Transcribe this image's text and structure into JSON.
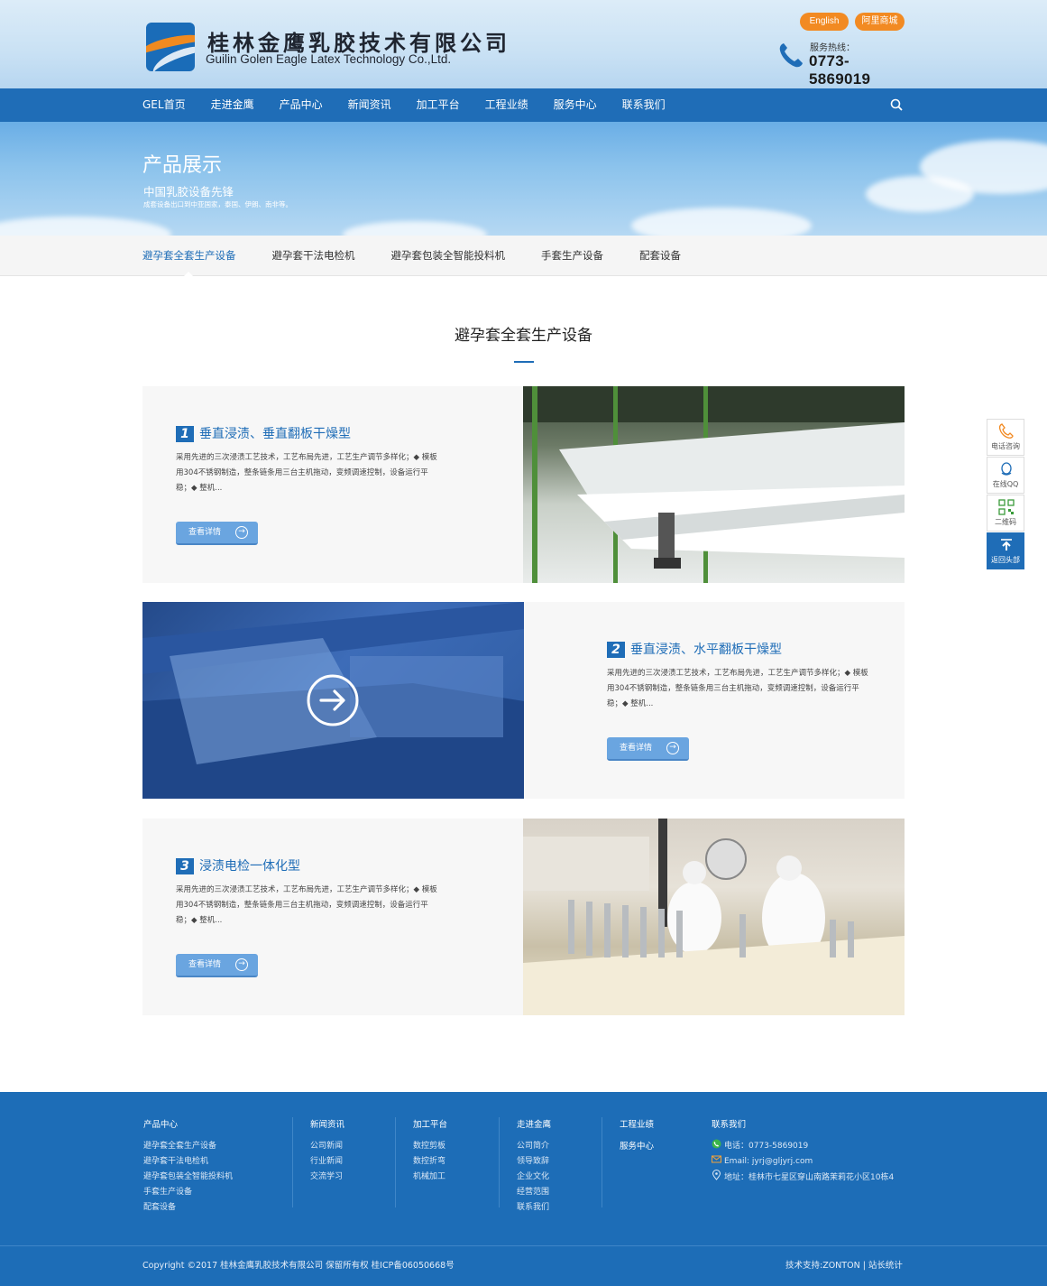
{
  "header": {
    "brand_cn": "桂林金鹰乳胶技术有限公司",
    "brand_en": "Guilin Golen Eagle Latex Technology Co.,Ltd.",
    "lang_english": "English",
    "lang_alibaba": "阿里商城",
    "hotline_label": "服务热线：",
    "hotline_number": "0773-5869019"
  },
  "nav": {
    "items": [
      "GEL首页",
      "走进金鹰",
      "产品中心",
      "新闻资讯",
      "加工平台",
      "工程业绩",
      "服务中心",
      "联系我们"
    ]
  },
  "banner": {
    "title": "产品展示",
    "subtitle": "中国乳胶设备先锋",
    "desc": "成套设备出口到中亚国家，泰国、伊朗、南非等。"
  },
  "tabs": {
    "items": [
      "避孕套全套生产设备",
      "避孕套干法电检机",
      "避孕套包装全智能投料机",
      "手套生产设备",
      "配套设备"
    ],
    "active_index": 0
  },
  "section": {
    "title": "避孕套全套生产设备"
  },
  "products": [
    {
      "num": "1",
      "title": "垂直浸渍、垂直翻板干燥型",
      "desc": "采用先进的三次浸渍工艺技术，工艺布局先进，工艺生产调节多样化；◆ 模板用304不锈钢制造，整条链条用三台主机拖动，变频调速控制，设备运行平稳；◆ 整机...",
      "button": "查看详情"
    },
    {
      "num": "2",
      "title": "垂直浸渍、水平翻板干燥型",
      "desc": "采用先进的三次浸渍工艺技术，工艺布局先进，工艺生产调节多样化；◆ 模板用304不锈钢制造，整条链条用三台主机拖动，变频调速控制，设备运行平稳；◆ 整机...",
      "button": "查看详情"
    },
    {
      "num": "3",
      "title": "浸渍电检一体化型",
      "desc": "采用先进的三次浸渍工艺技术，工艺布局先进，工艺生产调节多样化；◆ 模板用304不锈钢制造，整条链条用三台主机拖动，变频调速控制，设备运行平稳；◆ 整机...",
      "button": "查看详情"
    }
  ],
  "side": {
    "phone": "电话咨询",
    "qq": "在线QQ",
    "qrcode": "二维码",
    "top": "返回头部"
  },
  "footer": {
    "col1": {
      "title": "产品中心",
      "links": [
        "避孕套全套生产设备",
        "避孕套干法电检机",
        "避孕套包装全智能投料机",
        "手套生产设备",
        "配套设备"
      ]
    },
    "col2": {
      "title": "新闻资讯",
      "links": [
        "公司新闻",
        "行业新闻",
        "交流学习"
      ]
    },
    "col3": {
      "title": "加工平台",
      "links": [
        "数控剪板",
        "数控折弯",
        "机械加工"
      ]
    },
    "col4": {
      "title": "走进金鹰",
      "links": [
        "公司简介",
        "领导致辞",
        "企业文化",
        "经营范围",
        "联系我们"
      ]
    },
    "col5": {
      "title": "工程业绩",
      "links": [
        "服务中心"
      ]
    },
    "contact": {
      "title": "联系我们",
      "phone": "电话：0773-5869019",
      "email": "Email: jyrj@gljyrj.com",
      "address": "地址：桂林市七星区穿山南路茉莉花小区10栋4"
    },
    "copyright": "Copyright ©2017 桂林金鹰乳胶技术有限公司  保留所有权  桂ICP备06050668号",
    "support": "技术支持:ZONTON  |  站长统计"
  },
  "colors": {
    "primary": "#1f6db7",
    "accent": "#f28a22",
    "button": "#6aa5e0"
  }
}
